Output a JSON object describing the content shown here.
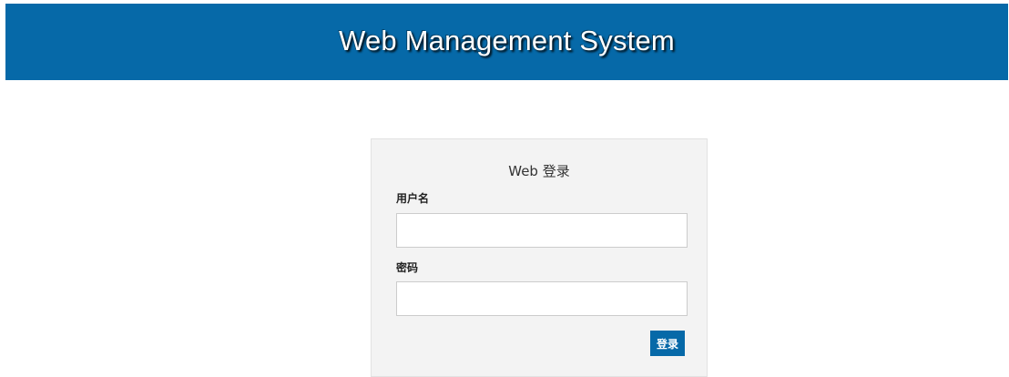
{
  "header": {
    "title": "Web Management System"
  },
  "login": {
    "title": "Web 登录",
    "username_label": "用户名",
    "username_value": "",
    "password_label": "密码",
    "password_value": "",
    "submit_label": "登录"
  },
  "colors": {
    "brand": "#0669a8",
    "panel_background": "#f3f3f3"
  }
}
